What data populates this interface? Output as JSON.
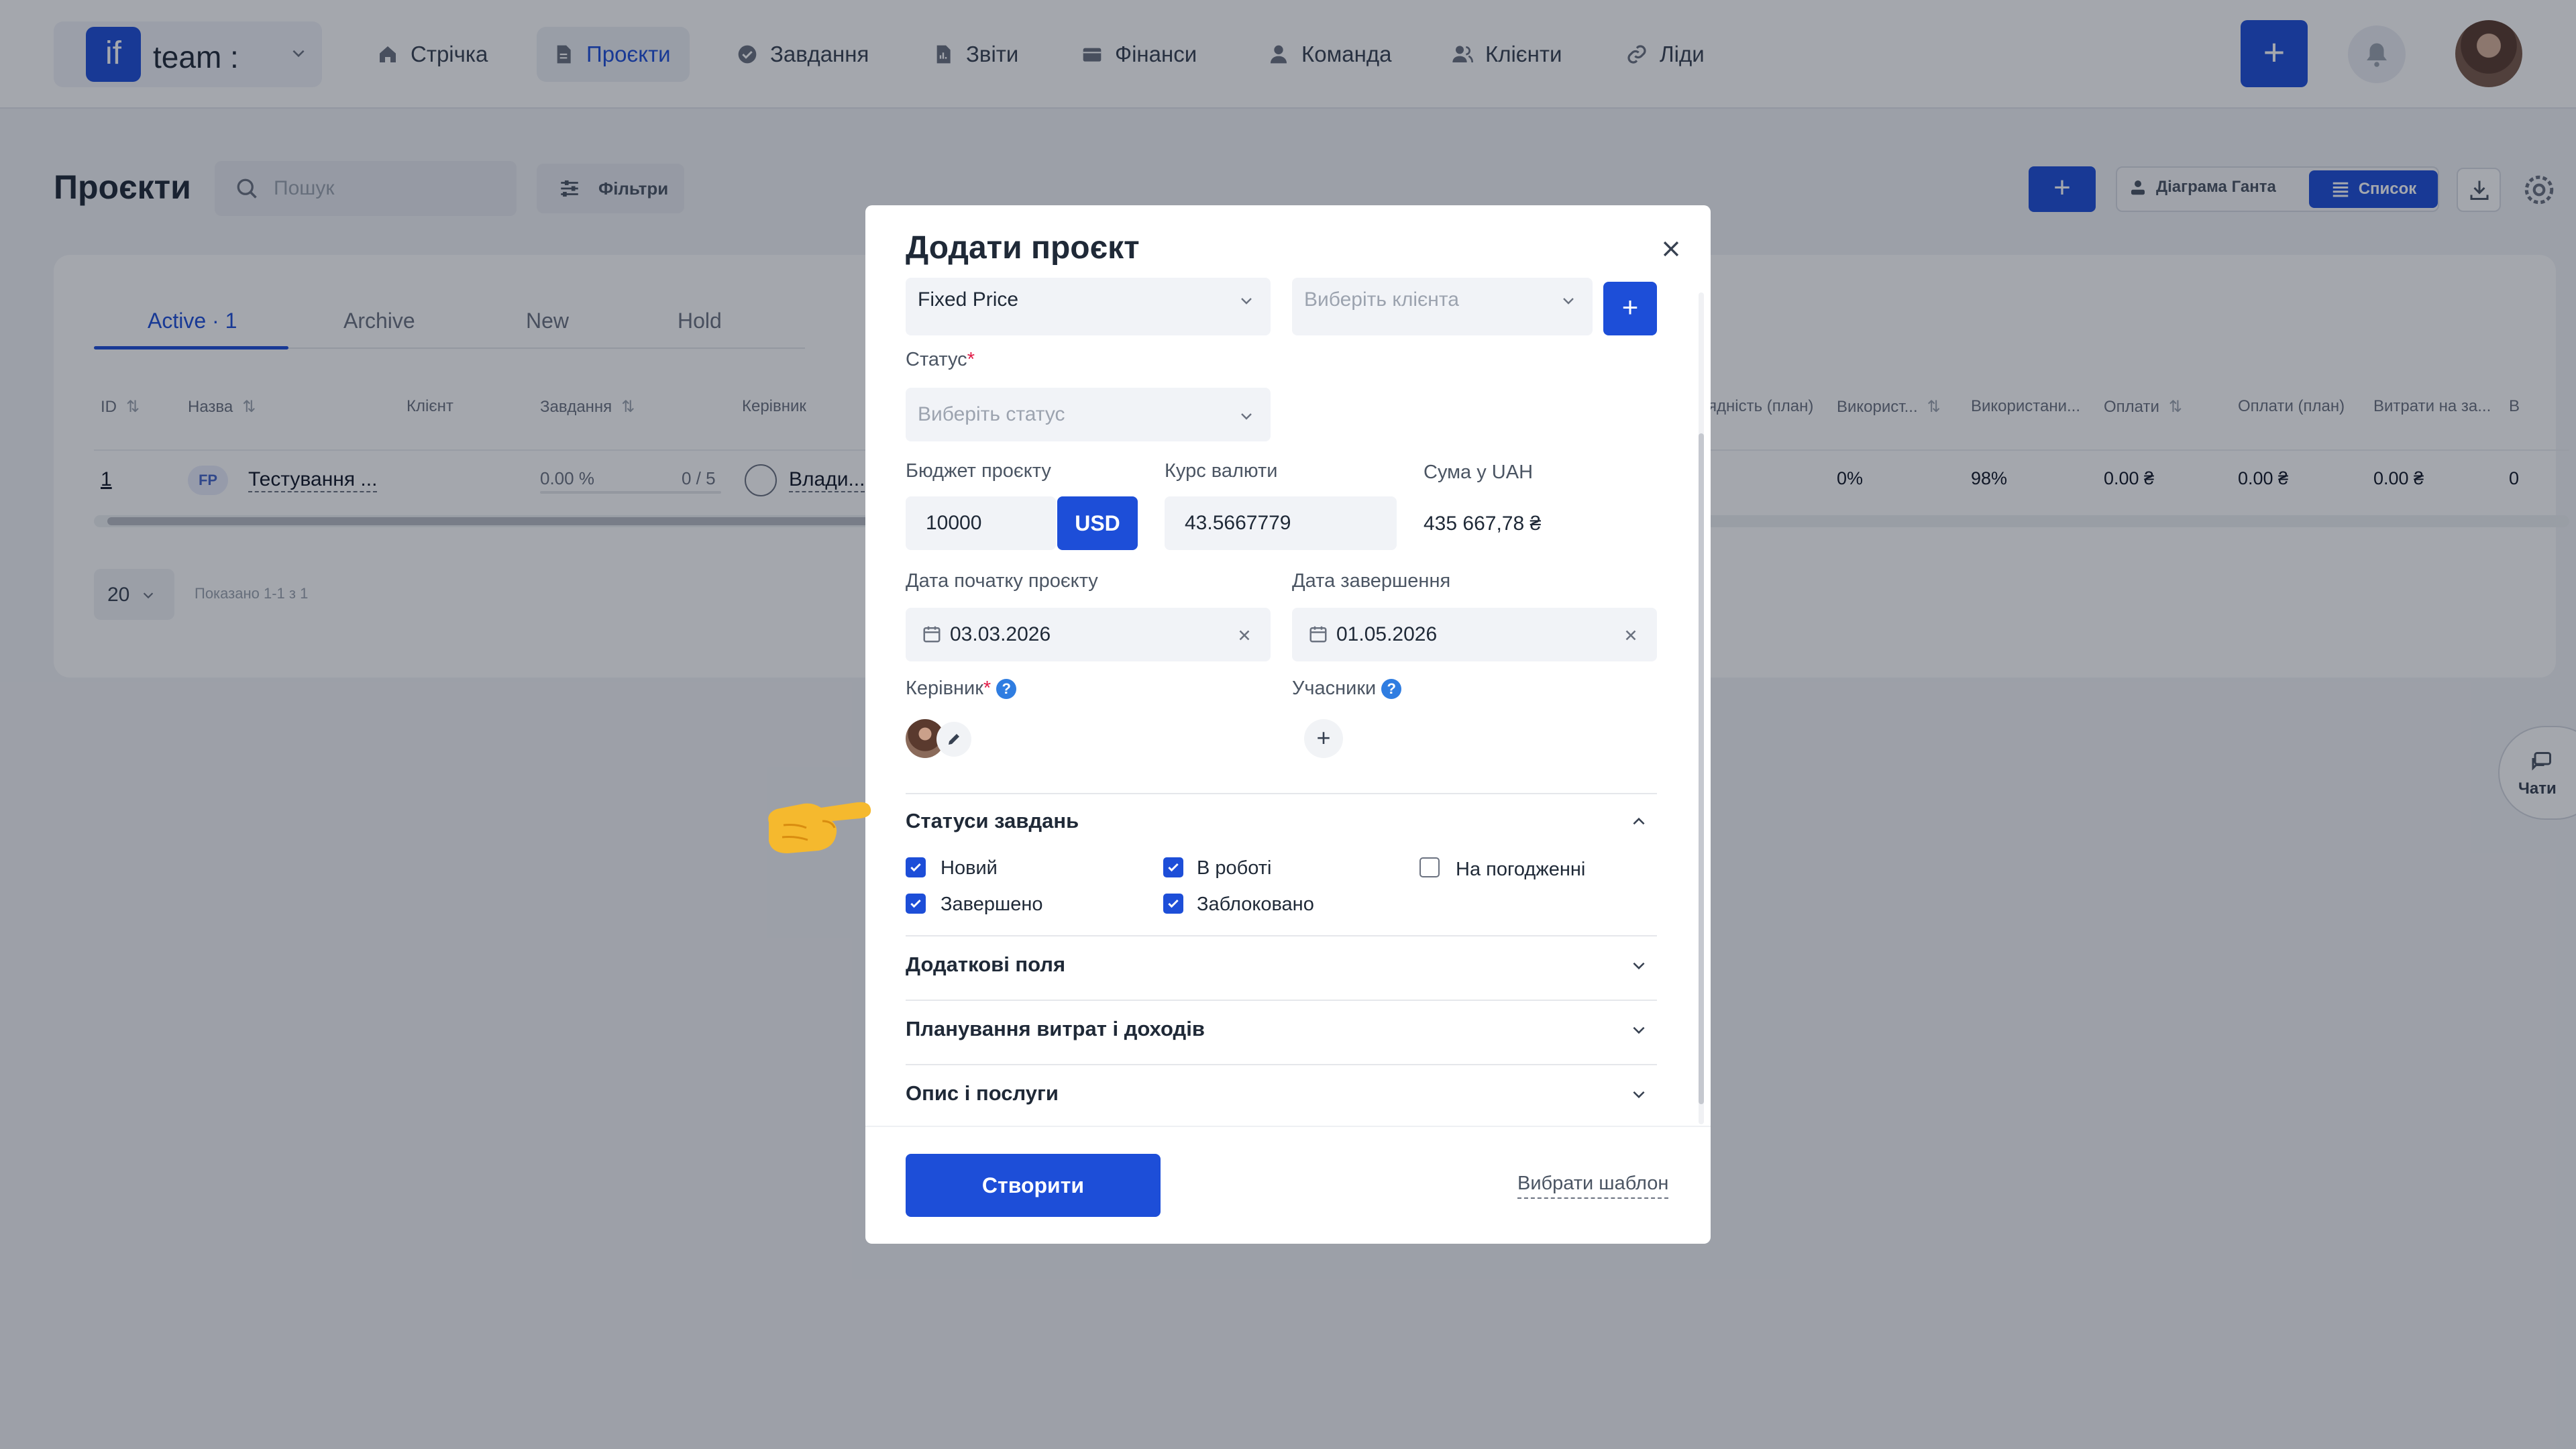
{
  "topnav": {
    "logo_text": "if",
    "workspace_name": "team :",
    "items": [
      {
        "label": "Стрічка",
        "icon": "home-icon"
      },
      {
        "label": "Проєкти",
        "icon": "document-icon"
      },
      {
        "label": "Завдання",
        "icon": "check-circle-icon"
      },
      {
        "label": "Звіти",
        "icon": "report-icon"
      },
      {
        "label": "Фінанси",
        "icon": "wallet-icon"
      },
      {
        "label": "Команда",
        "icon": "user-icon"
      },
      {
        "label": "Клієнти",
        "icon": "users-icon"
      },
      {
        "label": "Ліди",
        "icon": "link-icon"
      }
    ],
    "add_label": "+"
  },
  "page": {
    "title": "Проєкти",
    "search_placeholder": "Пошук",
    "filters_label": "Фільтри",
    "add_label": "+",
    "gantt_label": "Діаграма Ганта",
    "list_label": "Список"
  },
  "tabs": [
    {
      "label": "Active · 1"
    },
    {
      "label": "Archive"
    },
    {
      "label": "New"
    },
    {
      "label": "Hold"
    }
  ],
  "table": {
    "headers": [
      "ID",
      "Назва",
      "Клієнт",
      "Завдання",
      "Керівник",
      "ядність (план)",
      "Використ...",
      "Використани...",
      "Оплати",
      "Оплати (план)",
      "Витрати на за...",
      "В"
    ],
    "row": {
      "id": "1",
      "badge": "FP",
      "name": "Тестування ...",
      "tasks_percent": "0.00 %",
      "tasks_count": "0 / 5",
      "manager": "Влади...",
      "used": "0%",
      "used2": "98%",
      "payments": "0.00 ₴",
      "payments_plan": "0.00 ₴",
      "costs": "0.00 ₴",
      "last": "0"
    },
    "per_page": "20",
    "shown_text": "Показано 1-1 з 1"
  },
  "chats_label": "Чати",
  "modal": {
    "title": "Додати проєкт",
    "type_value": "Fixed Price",
    "client_placeholder": "Виберіть клієнта",
    "status_label": "Статус",
    "status_placeholder": "Виберіть статус",
    "budget_label": "Бюджет проєкту",
    "budget_value": "10000",
    "currency": "USD",
    "rate_label": "Курс валюти",
    "rate_value": "43.5667779",
    "sum_label": "Сума у UAH",
    "sum_value": "435 667,78 ₴",
    "start_label": "Дата початку проєкту",
    "start_value": "03.03.2026",
    "end_label": "Дата завершення",
    "end_value": "01.05.2026",
    "manager_label": "Керівник",
    "members_label": "Учасники",
    "task_statuses_title": "Статуси завдань",
    "statuses": [
      {
        "label": "Новий",
        "checked": true
      },
      {
        "label": "В роботі",
        "checked": true
      },
      {
        "label": "На погодженні",
        "checked": false
      },
      {
        "label": "Завершено",
        "checked": true
      },
      {
        "label": "Заблоковано",
        "checked": true
      }
    ],
    "sections": [
      {
        "title": "Додаткові поля"
      },
      {
        "title": "Планування витрат і доходів"
      },
      {
        "title": "Опис і послуги"
      }
    ],
    "create_label": "Створити",
    "template_label": "Вибрати шаблон"
  },
  "colors": {
    "accent": "#1d4ed8",
    "overlay": "rgba(17,24,39,0.38)",
    "required": "#e11d48",
    "help": "#2f7de1"
  }
}
